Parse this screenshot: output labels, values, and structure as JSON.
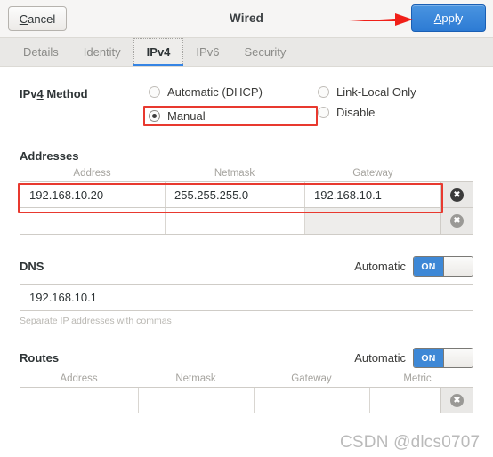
{
  "window": {
    "title": "Wired",
    "cancel_label": "Cancel",
    "cancel_mnemonic": "C",
    "cancel_rest": "ancel",
    "apply_label": "Apply",
    "apply_mnemonic": "A",
    "apply_rest": "pply"
  },
  "tabs": [
    {
      "label": "Details",
      "active": false
    },
    {
      "label": "Identity",
      "active": false
    },
    {
      "label": "IPv4",
      "active": true
    },
    {
      "label": "IPv6",
      "active": false
    },
    {
      "label": "Security",
      "active": false
    }
  ],
  "method": {
    "title_pre": "IPv",
    "title_mnemonic": "4",
    "title_post": " Method",
    "options": [
      {
        "label": "Automatic (DHCP)",
        "checked": false
      },
      {
        "label": "Manual",
        "checked": true
      },
      {
        "label": "Link-Local Only",
        "checked": false
      },
      {
        "label": "Disable",
        "checked": false
      }
    ]
  },
  "addresses": {
    "heading": "Addresses",
    "columns": [
      "Address",
      "Netmask",
      "Gateway"
    ],
    "rows": [
      {
        "address": "192.168.10.20",
        "netmask": "255.255.255.0",
        "gateway": "192.168.10.1"
      },
      {
        "address": "",
        "netmask": "",
        "gateway": ""
      }
    ],
    "delete_icon": "✖"
  },
  "dns": {
    "heading": "DNS",
    "automatic_label": "Automatic",
    "toggle_state": "ON",
    "value": "192.168.10.1",
    "placeholder": "",
    "hint": "Separate IP addresses with commas"
  },
  "routes": {
    "heading": "Routes",
    "automatic_label": "Automatic",
    "toggle_state": "ON",
    "columns": [
      "Address",
      "Netmask",
      "Gateway",
      "Metric"
    ],
    "rows": [
      {
        "address": "",
        "netmask": "",
        "gateway": "",
        "metric": ""
      }
    ]
  },
  "watermark": "CSDN @dlcs0707",
  "colors": {
    "accent_blue": "#3584e4",
    "apply_blue": "#2d7bd4",
    "annotation_red": "#e8392f",
    "header_bg": "#f6f5f4",
    "tab_bg": "#e9e8e6"
  }
}
